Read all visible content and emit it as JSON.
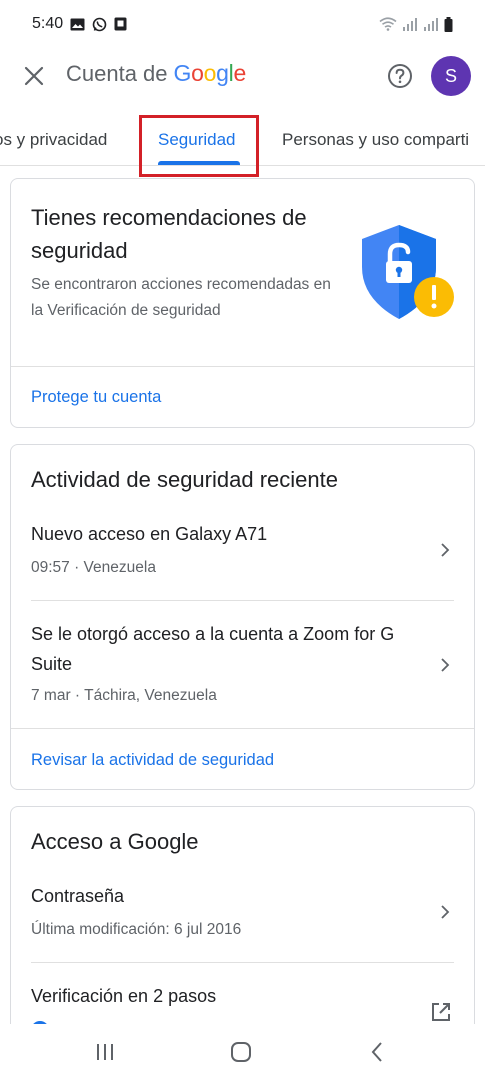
{
  "status_bar": {
    "time": "5:40"
  },
  "header": {
    "title_prefix": "Cuenta de",
    "google": [
      "G",
      "o",
      "o",
      "g",
      "l",
      "e"
    ],
    "google_colors": [
      "#4285F4",
      "#EA4335",
      "#FBBC05",
      "#4285F4",
      "#34A853",
      "#EA4335"
    ],
    "avatar_initial": "S",
    "avatar_color": "#5e35b1"
  },
  "tabs": [
    {
      "label": "os y privacidad"
    },
    {
      "label": "Seguridad",
      "selected": true
    },
    {
      "label": "Personas y uso comparti"
    }
  ],
  "recommendations": {
    "title": "Tienes recomendaciones de seguridad",
    "description": "Se encontraron acciones recomendadas en la Verificación de seguridad",
    "link": "Protege tu cuenta"
  },
  "recent_activity": {
    "title": "Actividad de seguridad reciente",
    "items": [
      {
        "title": "Nuevo acceso en Galaxy A71",
        "subtitle": "09:57 · Venezuela"
      },
      {
        "title": "Se le otorgó acceso a la cuenta a Zoom for G Suite",
        "subtitle": "7 mar · Táchira, Venezuela"
      }
    ],
    "link": "Revisar la actividad de seguridad"
  },
  "google_access": {
    "title": "Acceso a Google",
    "items": [
      {
        "title": "Contraseña",
        "subtitle": "Última modificación: 6 jul 2016"
      },
      {
        "title": "Verificación en 2 pasos"
      }
    ]
  },
  "colors": {
    "accent": "#1a73e8",
    "highlight": "#d32027",
    "warning": "#fbbc04"
  }
}
